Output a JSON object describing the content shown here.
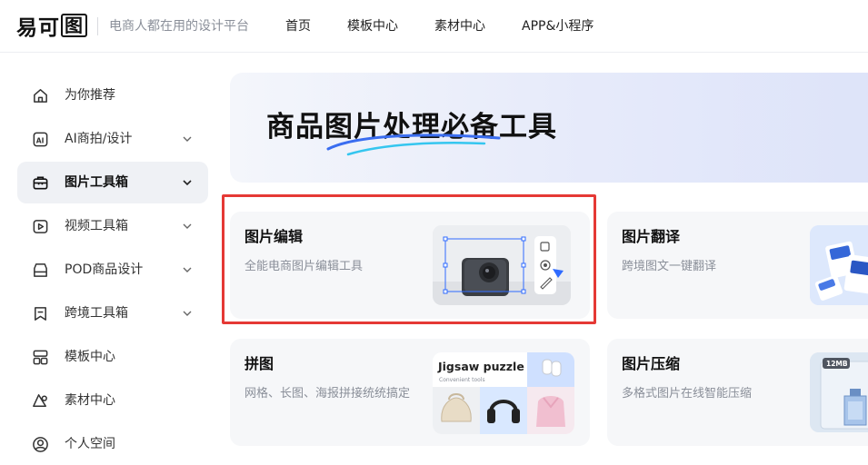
{
  "header": {
    "logo_text": "易可",
    "logo_box_text": "图",
    "slogan": "电商人都在用的设计平台",
    "nav": [
      "首页",
      "模板中心",
      "素材中心",
      "APP&小程序"
    ]
  },
  "sidebar": {
    "items": [
      {
        "label": "为你推荐",
        "icon": "home-icon",
        "expandable": false
      },
      {
        "label": "AI商拍/设计",
        "icon": "ai-icon",
        "expandable": true
      },
      {
        "label": "图片工具箱",
        "icon": "toolbox-icon",
        "expandable": true,
        "active": true
      },
      {
        "label": "视频工具箱",
        "icon": "video-icon",
        "expandable": true
      },
      {
        "label": "POD商品设计",
        "icon": "pod-icon",
        "expandable": true
      },
      {
        "label": "跨境工具箱",
        "icon": "crossborder-icon",
        "expandable": true
      },
      {
        "label": "模板中心",
        "icon": "template-icon",
        "expandable": false
      },
      {
        "label": "素材中心",
        "icon": "material-icon",
        "expandable": false
      },
      {
        "label": "个人空间",
        "icon": "user-icon",
        "expandable": false
      }
    ]
  },
  "banner": {
    "title": "商品图片处理必备工具"
  },
  "cards": [
    {
      "title": "图片编辑",
      "desc": "全能电商图片编辑工具"
    },
    {
      "title": "图片翻译",
      "desc": "跨境图文一键翻译"
    },
    {
      "title": "拼图",
      "desc": "网格、长图、海报拼接统统搞定",
      "image_title": "Jigsaw puzzle",
      "image_subtitle": "Convenient tools"
    },
    {
      "title": "图片压缩",
      "desc": "多格式图片在线智能压缩",
      "image_badge": "12MB"
    }
  ],
  "colors": {
    "accent_blue": "#2f6bff",
    "highlight_red": "#e53935",
    "active_bg": "#eff1f5"
  }
}
